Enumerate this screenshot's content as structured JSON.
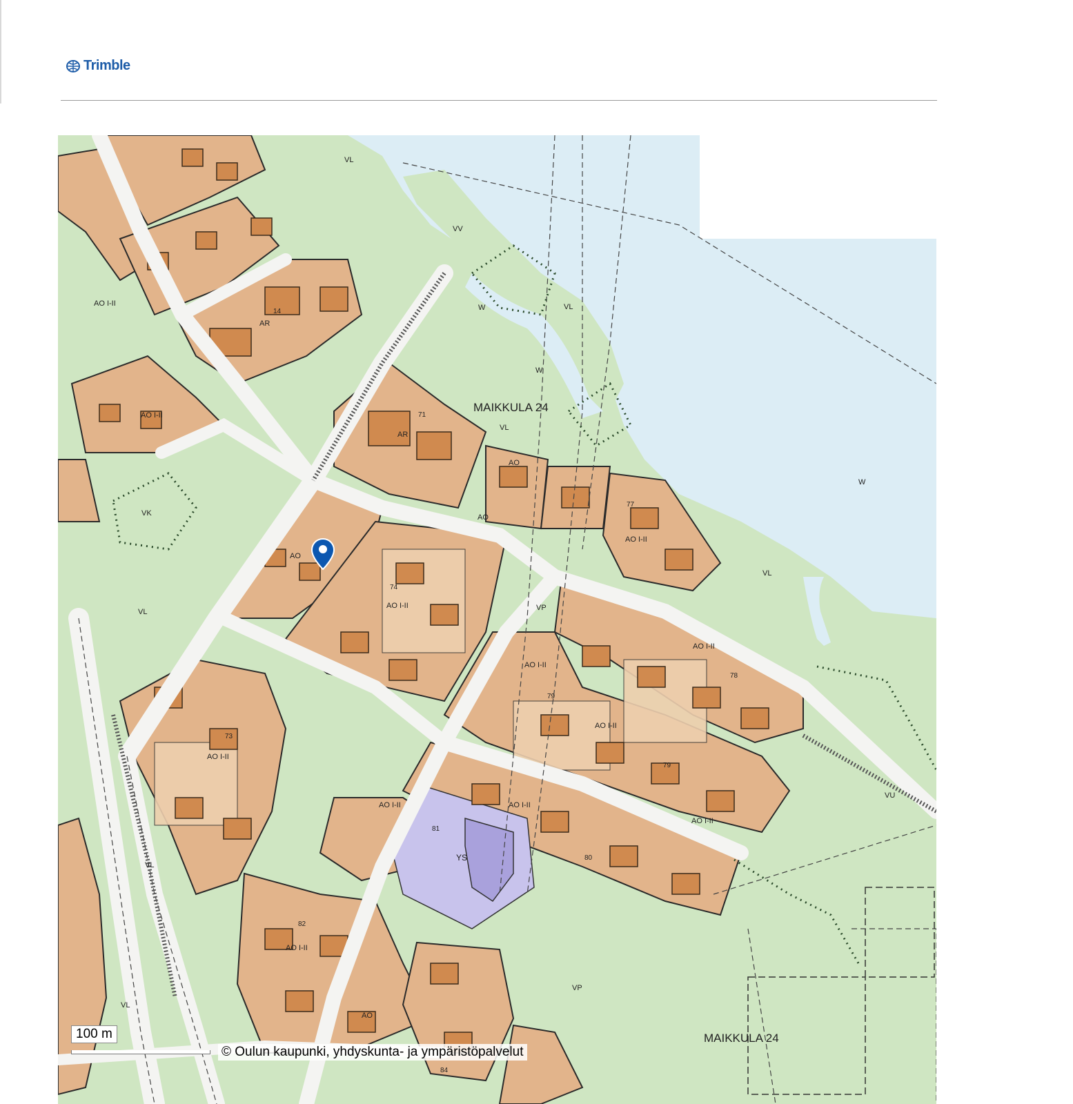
{
  "header": {
    "logo_text": "Trimble",
    "logo_icon": "trimble-globe-icon"
  },
  "map": {
    "district_labels": [
      {
        "id": "maikkula-upper",
        "text": "MAIKKULA 24"
      },
      {
        "id": "maikkula-lower",
        "text": "MAIKKULA 24"
      }
    ],
    "zone_labels": [
      {
        "id": "z-w-sea",
        "text": "W"
      },
      {
        "id": "z-vl-top",
        "text": "VL"
      },
      {
        "id": "z-vv",
        "text": "VV"
      },
      {
        "id": "z-w-creek",
        "text": "W"
      },
      {
        "id": "z-w-creek2",
        "text": "W"
      },
      {
        "id": "z-vl-island",
        "text": "VL"
      },
      {
        "id": "z-vl-mid",
        "text": "VL"
      },
      {
        "id": "z-vk",
        "text": "VK"
      },
      {
        "id": "z-vl-left",
        "text": "VL"
      },
      {
        "id": "z-vl-shore",
        "text": "VL"
      },
      {
        "id": "z-vp",
        "text": "VP"
      },
      {
        "id": "z-vu",
        "text": "VU"
      },
      {
        "id": "z-vp-lower",
        "text": "VP"
      },
      {
        "id": "z-vl-bottom",
        "text": "VL"
      },
      {
        "id": "z-vl-road",
        "text": "VL"
      },
      {
        "id": "z-ys",
        "text": "YS"
      }
    ],
    "block_labels": [
      {
        "id": "b71",
        "text": "71"
      },
      {
        "id": "b74",
        "text": "74"
      },
      {
        "id": "b77",
        "text": "77"
      },
      {
        "id": "b78",
        "text": "78"
      },
      {
        "id": "b79a",
        "text": "79"
      },
      {
        "id": "b79b",
        "text": "79"
      },
      {
        "id": "b80",
        "text": "80"
      },
      {
        "id": "b81",
        "text": "81"
      },
      {
        "id": "b82",
        "text": "82"
      },
      {
        "id": "b84",
        "text": "84"
      },
      {
        "id": "b73",
        "text": "73"
      },
      {
        "id": "b14",
        "text": "14"
      }
    ],
    "use_labels": [
      {
        "id": "u-ar1",
        "text": "AR"
      },
      {
        "id": "u-ar2",
        "text": "AR"
      },
      {
        "id": "u-ao1",
        "text": "AO"
      },
      {
        "id": "u-ao2",
        "text": "AO"
      },
      {
        "id": "u-ao3",
        "text": "AO I-II"
      },
      {
        "id": "u-ao4",
        "text": "AO I-II"
      },
      {
        "id": "u-ao5",
        "text": "AO I-II"
      },
      {
        "id": "u-ao6",
        "text": "AO I-II"
      },
      {
        "id": "u-ao7",
        "text": "AO I-II"
      },
      {
        "id": "u-ao8",
        "text": "AO I-II"
      },
      {
        "id": "u-ao9",
        "text": "AO I-II"
      },
      {
        "id": "u-ao10",
        "text": "AO I-II"
      },
      {
        "id": "u-ao11",
        "text": "AO I-II"
      },
      {
        "id": "u-ao12",
        "text": "AO I-II"
      },
      {
        "id": "u-ao13",
        "text": "AO I-II"
      },
      {
        "id": "u-ao14",
        "text": "AO I-II"
      },
      {
        "id": "u-ao15",
        "text": "AO"
      },
      {
        "id": "u-ao16",
        "text": "AO"
      }
    ],
    "scale_label": "100 m",
    "copyright": "© Oulun kaupunki, yhdyskunta- ja ympäristöpalvelut",
    "colors": {
      "water": "#dcedf5",
      "park": "#cfe6c2",
      "residential": "#e2b48b",
      "plot": "#eecfae",
      "building": "#d08a4f",
      "public": "#c8c3ec",
      "public_building": "#a9a1dc",
      "road": "#f4f4f2",
      "marker": "#0c57b0"
    }
  }
}
